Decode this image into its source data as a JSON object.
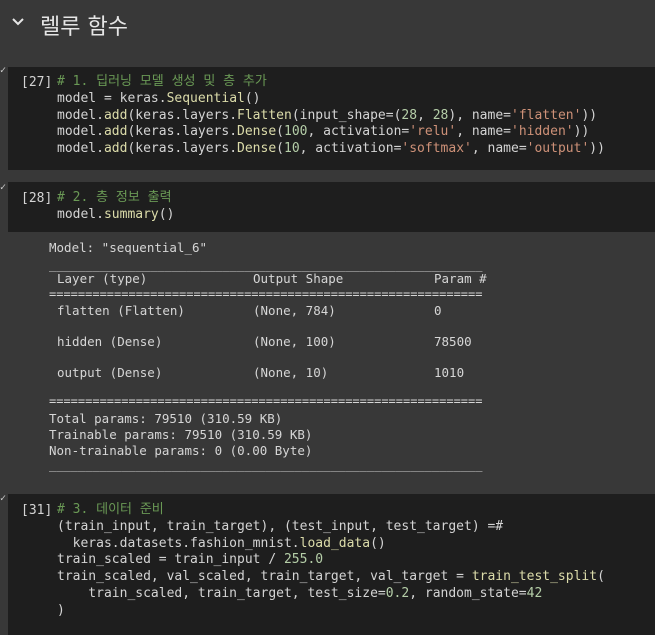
{
  "section": {
    "title": "렐루 함수"
  },
  "cell27": {
    "count": "[27]",
    "lines": [
      [
        {
          "t": "# 1. 딥러닝 모델 생성 및 층 추가",
          "c": "cm"
        }
      ],
      [
        {
          "t": "model = keras.",
          "c": "p1"
        },
        {
          "t": "Sequential",
          "c": "fn"
        },
        {
          "t": "()",
          "c": "p1"
        }
      ],
      [
        {
          "t": "model.",
          "c": "p1"
        },
        {
          "t": "add",
          "c": "fn"
        },
        {
          "t": "(keras.layers.",
          "c": "p1"
        },
        {
          "t": "Flatten",
          "c": "fn"
        },
        {
          "t": "(input_shape=(",
          "c": "p1"
        },
        {
          "t": "28",
          "c": "num"
        },
        {
          "t": ", ",
          "c": "p1"
        },
        {
          "t": "28",
          "c": "num"
        },
        {
          "t": "), name=",
          "c": "p1"
        },
        {
          "t": "'flatten'",
          "c": "str"
        },
        {
          "t": "))",
          "c": "p1"
        }
      ],
      [
        {
          "t": "model.",
          "c": "p1"
        },
        {
          "t": "add",
          "c": "fn"
        },
        {
          "t": "(keras.layers.",
          "c": "p1"
        },
        {
          "t": "Dense",
          "c": "fn"
        },
        {
          "t": "(",
          "c": "p1"
        },
        {
          "t": "100",
          "c": "num"
        },
        {
          "t": ", activation=",
          "c": "p1"
        },
        {
          "t": "'relu'",
          "c": "str"
        },
        {
          "t": ", name=",
          "c": "p1"
        },
        {
          "t": "'hidden'",
          "c": "str"
        },
        {
          "t": "))",
          "c": "p1"
        }
      ],
      [
        {
          "t": "model.",
          "c": "p1"
        },
        {
          "t": "add",
          "c": "fn"
        },
        {
          "t": "(keras.layers.",
          "c": "p1"
        },
        {
          "t": "Dense",
          "c": "fn"
        },
        {
          "t": "(",
          "c": "p1"
        },
        {
          "t": "10",
          "c": "num"
        },
        {
          "t": ", activation=",
          "c": "p1"
        },
        {
          "t": "'softmax'",
          "c": "str"
        },
        {
          "t": ", name=",
          "c": "p1"
        },
        {
          "t": "'output'",
          "c": "str"
        },
        {
          "t": "))",
          "c": "p1"
        }
      ]
    ]
  },
  "cell28": {
    "count": "[28]",
    "lines": [
      [
        {
          "t": "# 2. 층 정보 출력",
          "c": "cm"
        }
      ],
      [
        {
          "t": "model.",
          "c": "p1"
        },
        {
          "t": "summary",
          "c": "fn"
        },
        {
          "t": "()",
          "c": "p1"
        }
      ]
    ],
    "output": {
      "model_line": "Model: \"sequential_6\"",
      "headers": [
        "Layer (type)",
        "Output Shape",
        "Param #"
      ],
      "rows": [
        [
          "flatten (Flatten)",
          "(None, 784)",
          "0"
        ],
        [
          "hidden (Dense)",
          "(None, 100)",
          "78500"
        ],
        [
          "output (Dense)",
          "(None, 10)",
          "1010"
        ]
      ],
      "total": "Total params: 79510 (310.59 KB)",
      "trainable": "Trainable params: 79510 (310.59 KB)",
      "non_trainable": "Non-trainable params: 0 (0.00 Byte)"
    }
  },
  "cell31": {
    "count": "[31]",
    "lines": [
      [
        {
          "t": "# 3. 데이터 준비",
          "c": "cm"
        }
      ],
      [
        {
          "t": "(train_input, train_target), (test_input, test_target) =#",
          "c": "p1"
        }
      ],
      [
        {
          "t": "  keras.datasets.fashion_mnist.",
          "c": "p1"
        },
        {
          "t": "load_data",
          "c": "fn"
        },
        {
          "t": "()",
          "c": "p1"
        }
      ],
      [
        {
          "t": "train_scaled = train_input / ",
          "c": "p1"
        },
        {
          "t": "255.0",
          "c": "num"
        }
      ],
      [
        {
          "t": "train_scaled, val_scaled, train_target, val_target = ",
          "c": "p1"
        },
        {
          "t": "train_test_split",
          "c": "fn"
        },
        {
          "t": "(",
          "c": "p1"
        }
      ],
      [
        {
          "t": "    train_scaled, train_target, test_size=",
          "c": "p1"
        },
        {
          "t": "0.2",
          "c": "num"
        },
        {
          "t": ", random_state=",
          "c": "p1"
        },
        {
          "t": "42",
          "c": "num"
        }
      ],
      [
        {
          "t": ")",
          "c": "p1"
        }
      ]
    ]
  },
  "colors": {
    "comment": "#6a9955",
    "string": "#ce9178",
    "number": "#b5cea8",
    "function": "#dcdcaa",
    "cell_bg": "#1e1e1e",
    "page_bg": "#383838"
  },
  "icons": {
    "collapse": "chevron-down-icon",
    "run_status": "checkmark-icon"
  }
}
